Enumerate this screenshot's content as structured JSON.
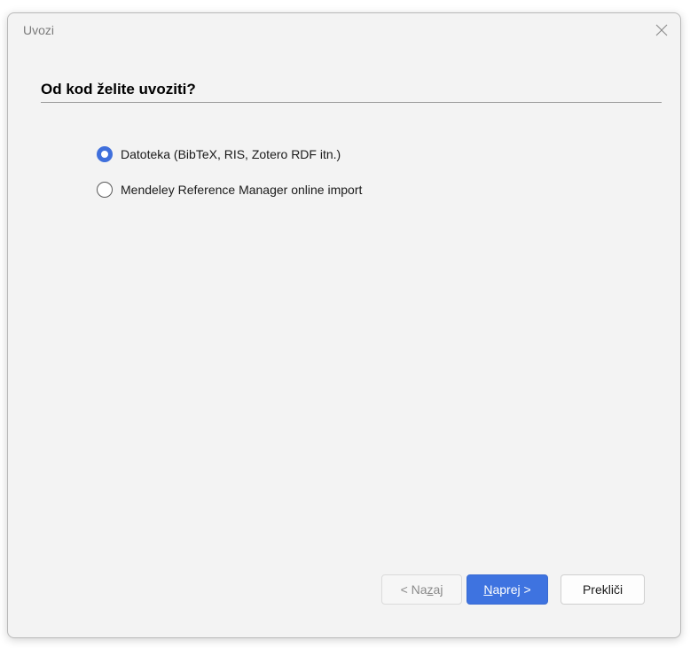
{
  "window": {
    "title": "Uvozi",
    "close_icon": "close-icon"
  },
  "page": {
    "heading": "Od kod želite uvoziti?"
  },
  "options": [
    {
      "label": "Datoteka (BibTeX, RIS, Zotero RDF itn.)",
      "selected": true
    },
    {
      "label": "Mendeley Reference Manager online import",
      "selected": false
    }
  ],
  "buttons": {
    "back": {
      "prefix": "< Na",
      "mnemonic": "z",
      "suffix": "aj",
      "enabled": false
    },
    "next": {
      "prefix": "",
      "mnemonic": "N",
      "suffix": "aprej >",
      "enabled": true
    },
    "cancel": {
      "label": "Prekliči"
    }
  },
  "colors": {
    "accent": "#3e73e0",
    "background": "#f3f3f3"
  }
}
